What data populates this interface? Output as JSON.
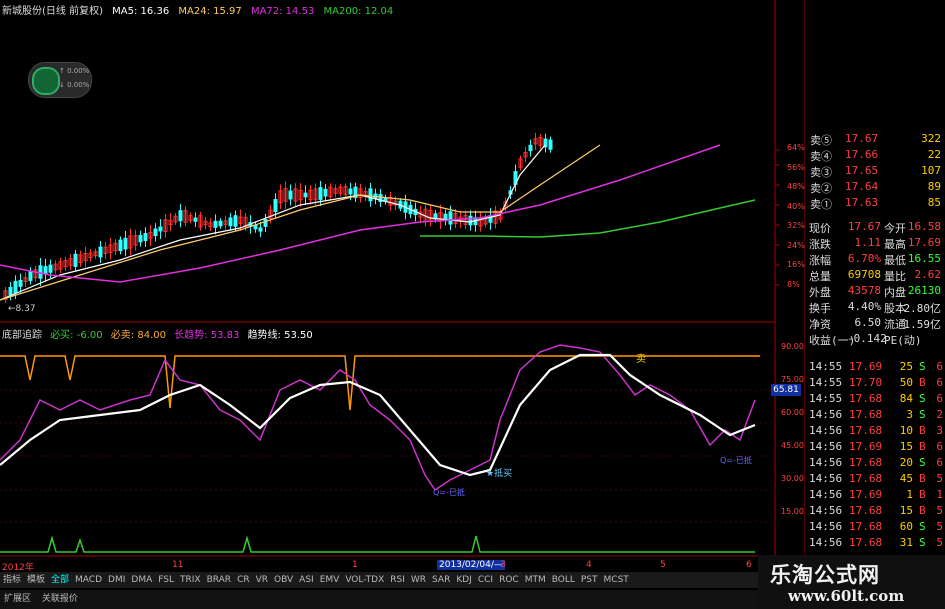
{
  "ma_header": {
    "stock": "新城股份(日线 前复权)",
    "ma5": "MA5: 16.36",
    "ma24": "MA24: 15.97",
    "ma72": "MA72: 14.53",
    "ma200": "MA200: 12.04"
  },
  "colors": {
    "ma5": "#ffffff",
    "ma24": "#ffcc66",
    "ma72": "#e030e0",
    "ma200": "#33cc33",
    "up": "#ff3030",
    "down": "#33ffff"
  },
  "badge": {
    "line1": "↑ 0.00%",
    "line2": "↓ 0.00%"
  },
  "price_scale": [
    "64%",
    "56%",
    "48%",
    "40%",
    "32%",
    "24%",
    "16%",
    "8%"
  ],
  "low_marker": "←8.37",
  "indicator_header": {
    "name": "底部追踪",
    "buy": "必买: -6.00",
    "sell": "必卖: 84.00",
    "long": "长趋势: 53.83",
    "trend": "趋势线: 53.50"
  },
  "indicator_scale": [
    "90.00",
    "75.00",
    "60.00",
    "45.00",
    "30.00",
    "15.00"
  ],
  "indicator_value_tag": "65.81",
  "indicator_labels": {
    "sell_tag": "卖",
    "buy_tag": "★抵买",
    "low_a": "Q=-已抵",
    "low_b": "Q=-已抵"
  },
  "date_axis": {
    "year": "2012年",
    "ticks": [
      "11",
      "1",
      "2013/02/04/—",
      "3",
      "4",
      "5",
      "6"
    ]
  },
  "asks": [
    {
      "label": "卖⑤",
      "price": "17.67",
      "vol": "322"
    },
    {
      "label": "卖④",
      "price": "17.66",
      "vol": "22"
    },
    {
      "label": "卖③",
      "price": "17.65",
      "vol": "107"
    },
    {
      "label": "卖②",
      "price": "17.64",
      "vol": "89"
    },
    {
      "label": "卖①",
      "price": "17.63",
      "vol": "85"
    }
  ],
  "quote": [
    {
      "k1": "现价",
      "v1": "17.67",
      "k2": "今开",
      "v2": "16.58"
    },
    {
      "k1": "涨跌",
      "v1": "1.11",
      "k2": "最高",
      "v2": "17.69"
    },
    {
      "k1": "涨幅",
      "v1": "6.70%",
      "k2": "最低",
      "v2": "16.55"
    },
    {
      "k1": "总量",
      "v1": "69708",
      "k2": "量比",
      "v2": "2.62"
    },
    {
      "k1": "外盘",
      "v1": "43578",
      "k2": "内盘",
      "v2": "26130"
    },
    {
      "k1": "换手",
      "v1": "4.40%",
      "k2": "股本",
      "v2": "2.80亿"
    },
    {
      "k1": "净资",
      "v1": "6.50",
      "k2": "流通",
      "v2": "1.59亿"
    },
    {
      "k1": "收益(一)",
      "v1": "-0.142",
      "k2": "PE(动)",
      "v2": ""
    }
  ],
  "trades": [
    {
      "t": "14:55",
      "p": "17.69",
      "v": "25",
      "f": "S",
      "x": "6"
    },
    {
      "t": "14:55",
      "p": "17.70",
      "v": "50",
      "f": "B",
      "x": "6"
    },
    {
      "t": "14:55",
      "p": "17.68",
      "v": "84",
      "f": "S",
      "x": "6"
    },
    {
      "t": "14:56",
      "p": "17.68",
      "v": "3",
      "f": "S",
      "x": "2"
    },
    {
      "t": "14:56",
      "p": "17.68",
      "v": "10",
      "f": "B",
      "x": "3"
    },
    {
      "t": "14:56",
      "p": "17.69",
      "v": "15",
      "f": "B",
      "x": "6"
    },
    {
      "t": "14:56",
      "p": "17.68",
      "v": "20",
      "f": "S",
      "x": "6"
    },
    {
      "t": "14:56",
      "p": "17.68",
      "v": "45",
      "f": "B",
      "x": "5"
    },
    {
      "t": "14:56",
      "p": "17.69",
      "v": "1",
      "f": "B",
      "x": "1"
    },
    {
      "t": "14:56",
      "p": "17.68",
      "v": "15",
      "f": "B",
      "x": "5"
    },
    {
      "t": "14:56",
      "p": "17.68",
      "v": "60",
      "f": "S",
      "x": "5"
    },
    {
      "t": "14:56",
      "p": "17.68",
      "v": "31",
      "f": "S",
      "x": "5"
    }
  ],
  "tabs": [
    "指标",
    "模板",
    "全部",
    "MACD",
    "DMI",
    "DMA",
    "FSL",
    "TRIX",
    "BRAR",
    "CR",
    "VR",
    "OBV",
    "ASI",
    "EMV",
    "VOL-TDX",
    "RSI",
    "WR",
    "SAR",
    "KDJ",
    "CCI",
    "ROC",
    "MTM",
    "BOLL",
    "PST",
    "MCST"
  ],
  "bottom_bar": [
    "扩展区",
    "关联报价"
  ],
  "watermark": {
    "title": "乐淘公式网",
    "url": "www.60lt.com"
  }
}
